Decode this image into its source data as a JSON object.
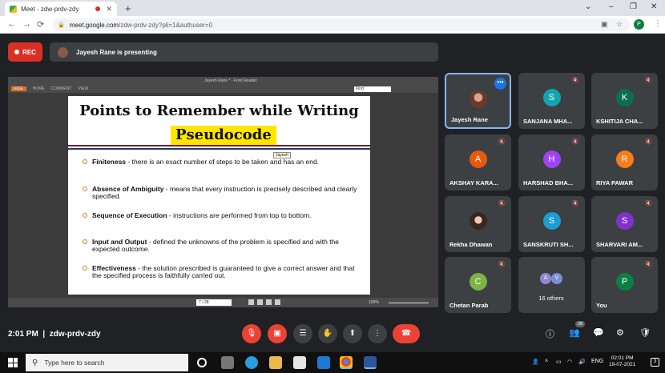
{
  "browser": {
    "tab_title": "Meet - zdw-prdv-zdy",
    "url_host": "meet.google.com",
    "url_path": "/zdw-prdv-zdy?pli=1&authuser=0",
    "profile_initial": "P"
  },
  "meet": {
    "rec_label": "REC",
    "presenting_label": "Jayesh Rane is presenting",
    "time": "2:01 PM",
    "meeting_code": "zdw-prdv-zdy",
    "participant_badge": "28"
  },
  "reader": {
    "window_title": "Jayesh Rane * - Foxit Reader",
    "menu": [
      "FILE",
      "HOME",
      "COMMENT",
      "VIEW"
    ],
    "search_placeholder": "Find",
    "page_indicator": "7 / 28",
    "zoom": "100%"
  },
  "slide": {
    "title": "Points to Remember while Writing",
    "subtitle": "Pseudocode",
    "tooltip": "Jayesh",
    "bullets": [
      {
        "term": "Finiteness",
        "text": " - there is an exact number of steps to be taken and has an end."
      },
      {
        "term": "Absence of Ambiguity",
        "text": " - means that every instruction is precisely described and clearly specified."
      },
      {
        "term": "Sequence of Execution",
        "text": " - instructions are performed from top to bottom."
      },
      {
        "term": "Input and Output",
        "text": " - defined the unknowns of the problem is specified and with the expected outcome."
      },
      {
        "term": "Effectiveness",
        "text": " - the solution prescribed is guaranteed to give a correct answer and that the specified process is faithfully carried out."
      }
    ]
  },
  "participants": [
    {
      "name": "Jayesh Rane",
      "initial": "",
      "color": "",
      "photo": true,
      "active": true
    },
    {
      "name": "SANJANA MHA...",
      "initial": "S",
      "color": "#12a4af"
    },
    {
      "name": "KSHITIJA CHA...",
      "initial": "K",
      "color": "#0b6e4f"
    },
    {
      "name": "AKSHAY KARA...",
      "initial": "A",
      "color": "#e8590c"
    },
    {
      "name": "HARSHAD BHA...",
      "initial": "H",
      "color": "#a142f4"
    },
    {
      "name": "RIYA PAWAR",
      "initial": "R",
      "color": "#fa7b17"
    },
    {
      "name": "Rekha Dhawan",
      "initial": "",
      "color": "",
      "photo": true
    },
    {
      "name": "SANSKRUTI SH...",
      "initial": "S",
      "color": "#1a9ed1"
    },
    {
      "name": "SHARVARI AM...",
      "initial": "S",
      "color": "#8430ce"
    },
    {
      "name": "Chetan Parab",
      "initial": "C",
      "color": "#7cb342"
    },
    {
      "name": "16 others",
      "initial": "",
      "color": "",
      "others": true,
      "mini": [
        {
          "initial": "A",
          "color": "#8e86d6"
        },
        {
          "initial": "V",
          "color": "#7b8fd9"
        }
      ]
    },
    {
      "name": "You",
      "initial": "P",
      "color": "#0b8043"
    }
  ],
  "taskbar": {
    "search_placeholder": "Type here to search",
    "lang": "ENG",
    "time": "02:01 PM",
    "date": "19-07-2021",
    "notif_count": "3"
  }
}
